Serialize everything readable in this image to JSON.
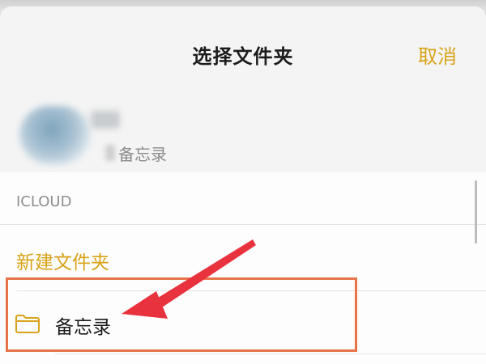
{
  "header": {
    "title": "选择文件夹",
    "cancel_label": "取消"
  },
  "note_preview": {
    "folder_name": "备忘录"
  },
  "sections": [
    {
      "header": "ICLOUD",
      "new_folder_label": "新建文件夹",
      "folders": [
        {
          "label": "备忘录",
          "icon": "folder-icon"
        }
      ]
    }
  ],
  "colors": {
    "accent": "#d8a318",
    "highlight_box": "#e8744a",
    "annotation_arrow": "#e8333f"
  }
}
